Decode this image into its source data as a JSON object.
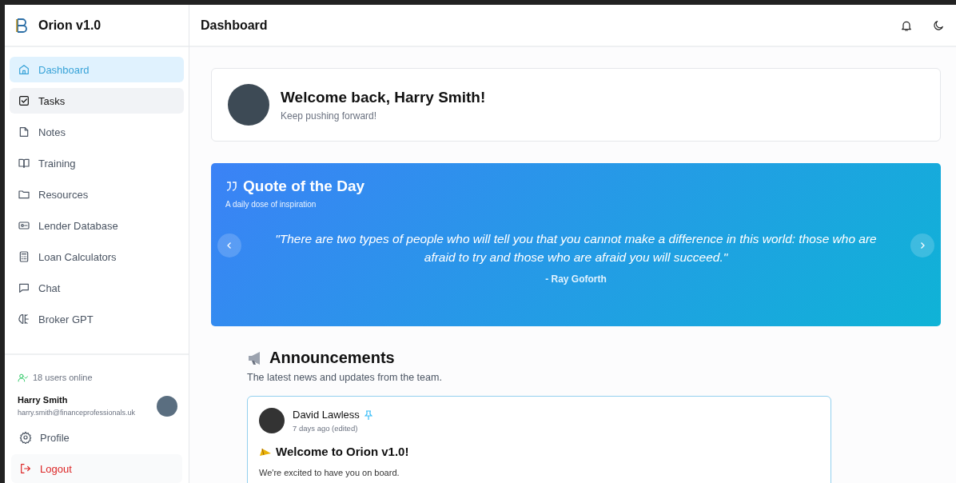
{
  "app": {
    "name": "Orion v1.0"
  },
  "sidebar": {
    "items": [
      {
        "label": "Dashboard",
        "kind": "home",
        "selected": true,
        "hovered": false
      },
      {
        "label": "Tasks",
        "kind": "tasks",
        "selected": false,
        "hovered": true
      },
      {
        "label": "Notes",
        "kind": "file",
        "selected": false,
        "hovered": false
      },
      {
        "label": "Training",
        "kind": "book",
        "selected": false,
        "hovered": false
      },
      {
        "label": "Resources",
        "kind": "folder",
        "selected": false,
        "hovered": false
      },
      {
        "label": "Lender Database",
        "kind": "card",
        "selected": false,
        "hovered": false
      },
      {
        "label": "Loan Calculators",
        "kind": "calculator",
        "selected": false,
        "hovered": false
      },
      {
        "label": "Chat",
        "kind": "chat",
        "selected": false,
        "hovered": false
      },
      {
        "label": "Broker GPT",
        "kind": "brain",
        "selected": false,
        "hovered": false
      }
    ],
    "online": "18 users online",
    "user": {
      "name": "Harry Smith",
      "email": "harry.smith@financeprofessionals.uk"
    },
    "footer_items": [
      {
        "label": "Profile",
        "kind": "gear"
      },
      {
        "label": "Logout",
        "kind": "logout"
      }
    ]
  },
  "header": {
    "title": "Dashboard"
  },
  "welcome": {
    "title": "Welcome back, Harry Smith!",
    "subtitle": "Keep pushing forward!"
  },
  "quote": {
    "title": "Quote of the Day",
    "subtitle": "A daily dose of inspiration",
    "text": "\"There are two types of people who will tell you that you cannot make a difference in this world: those who are afraid to try and those who are afraid you will succeed.\"",
    "author": "- Ray Goforth"
  },
  "announcements": {
    "title": "Announcements",
    "subtitle": "The latest news and updates from the team.",
    "posts": [
      {
        "author": "David Lawless",
        "pinned": true,
        "time": "7 days ago (edited)",
        "title": "Welcome to Orion v1.0!",
        "body": "We're excited to have you on board."
      }
    ]
  }
}
